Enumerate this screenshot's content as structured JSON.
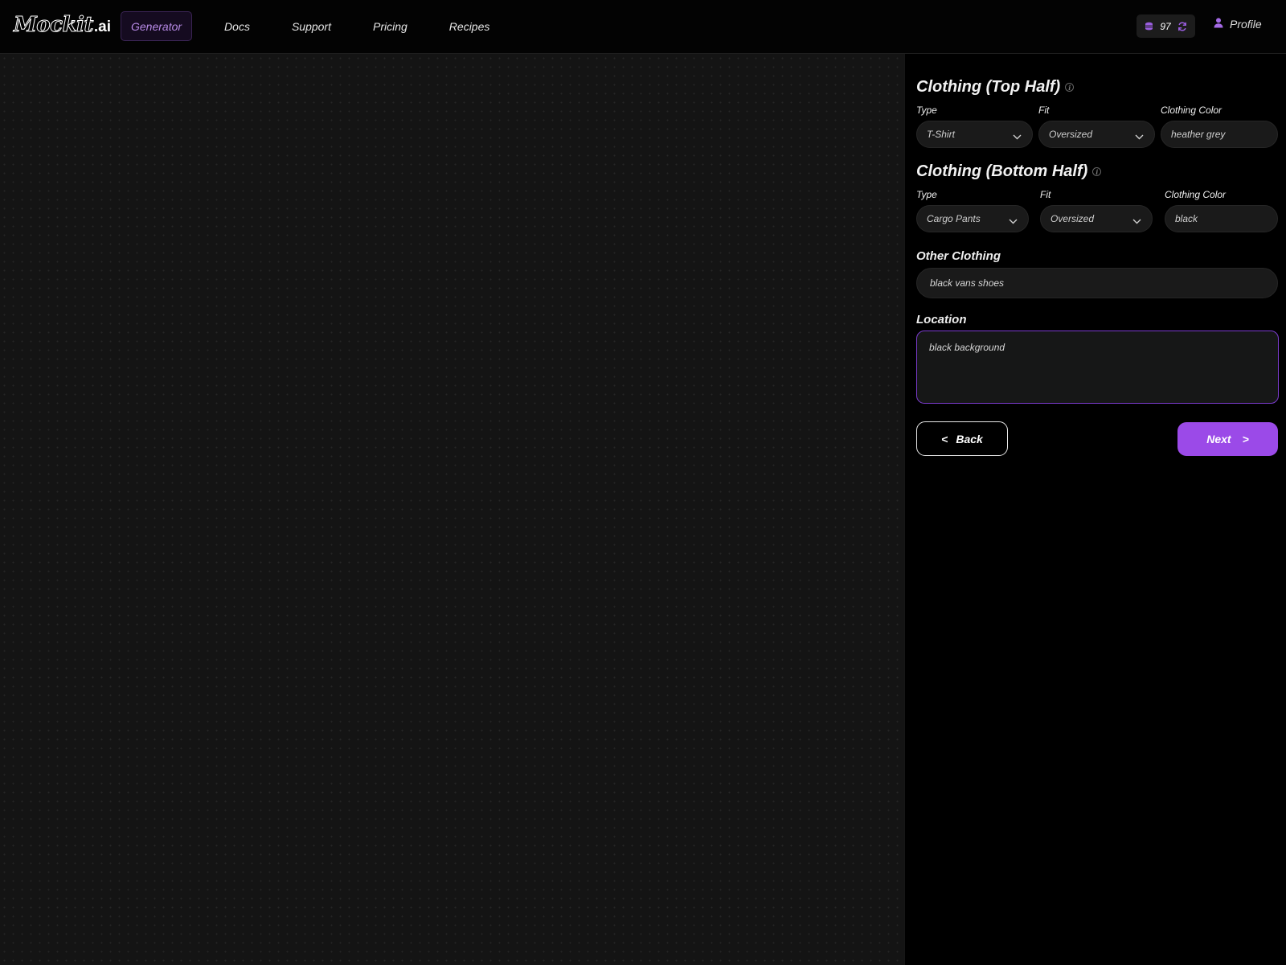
{
  "brand": {
    "script": "Mockit",
    "tld": ".ai"
  },
  "nav": {
    "items": [
      "Generator",
      "Docs",
      "Support",
      "Pricing",
      "Recipes"
    ]
  },
  "header": {
    "credits": "97",
    "profile_label": "Profile"
  },
  "top_half": {
    "title": "Clothing (Top Half)",
    "type_label": "Type",
    "type_value": "T-Shirt",
    "fit_label": "Fit",
    "fit_value": "Oversized",
    "color_label": "Clothing Color",
    "color_value": "heather grey"
  },
  "bottom_half": {
    "title": "Clothing (Bottom Half)",
    "type_label": "Type",
    "type_value": "Cargo Pants",
    "fit_label": "Fit",
    "fit_value": "Oversized",
    "color_label": "Clothing Color",
    "color_value": "black"
  },
  "other_clothing": {
    "label": "Other Clothing",
    "value": "black vans shoes"
  },
  "location": {
    "label": "Location",
    "value": "black background"
  },
  "actions": {
    "back_arrow": "<",
    "back_label": "Back",
    "next_label": "Next",
    "next_arrow": ">"
  },
  "colors": {
    "accent": "#9b4ae8",
    "focus_border": "#7c3cd0",
    "nav_active_text": "#b78ae6"
  },
  "icons": {
    "credits": "coins-icon",
    "refresh": "refresh-icon",
    "profile": "user-icon",
    "info": "info-icon",
    "dropdown": "chevron-down-icon"
  }
}
